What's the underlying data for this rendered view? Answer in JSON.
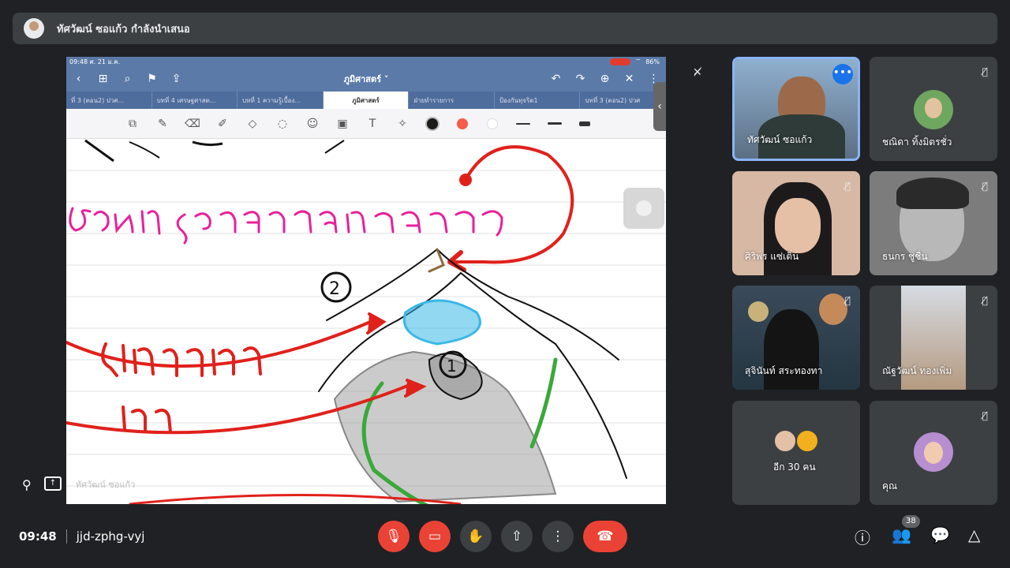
{
  "topbar": {
    "presenting_text": "ทัศวัฒน์ ซอแก้ว กำลังนำเสนอ"
  },
  "ipad": {
    "status_time": "09:48  ศ. 21 ม.ค.",
    "status_battery": "86%",
    "doc_title": "ภูมิศาสตร์ ˅",
    "tabs": [
      "ที่ 3 (ตอน2) ปวศ...",
      "บทที่ 4 เศรษฐศาสต...",
      "บทที่ 1 ความรู้เบื้อง...",
      "ภูมิศาสตร์",
      "ฝ่ายทำรายการ",
      "ป้องกันทุจริต1",
      "บทที่ 3 (ตอน2) ปวศ"
    ],
    "colors": {
      "black": "#1a1a1a",
      "red": "#f45b49",
      "white": "#ffffff"
    }
  },
  "canvas": {
    "ink_colors": {
      "pink": "#e8209a",
      "red": "#e0211b",
      "black": "#111111",
      "blue": "#39b8e6",
      "green": "#3aa83a",
      "gray": "#a0a0a0"
    }
  },
  "presenter_label": "ทัศวัฒน์ ซอแก้ว",
  "participants": [
    {
      "name": "ทัศวัฒน์ ซอแก้ว"
    },
    {
      "name": "ชณิดา ทิ้งมิตรชั่ว"
    },
    {
      "name": "ศิริพร แซ่เติ่น"
    },
    {
      "name": "ธนกร ชูชื่น"
    },
    {
      "name": "สุจินันท์ สระทองทา"
    },
    {
      "name": "ณัฐวัฒน์ ทองเพิ่ม"
    },
    {
      "name": "อีก 30 คน"
    },
    {
      "name": "คุณ"
    }
  ],
  "meeting": {
    "time": "09:48",
    "code": "jjd-zphg-vyj",
    "participant_count": "38"
  }
}
